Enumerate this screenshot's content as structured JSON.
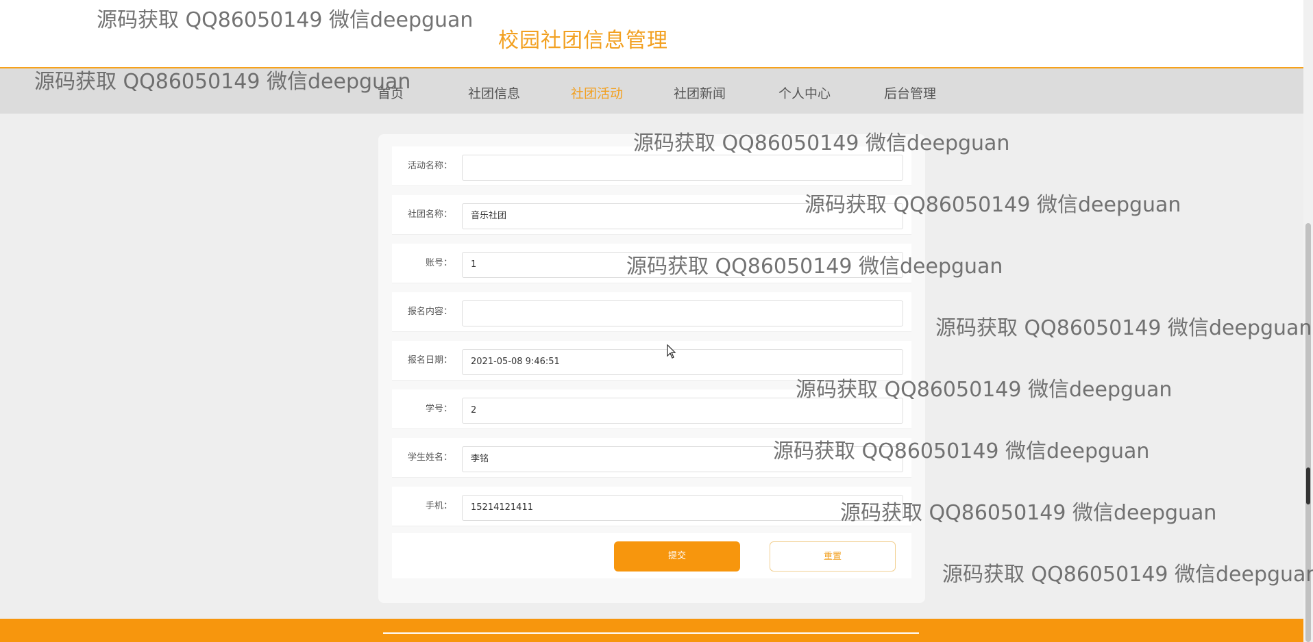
{
  "header": {
    "title": "校园社团信息管理"
  },
  "nav": {
    "items": [
      {
        "label": "首页",
        "active": false
      },
      {
        "label": "社团信息",
        "active": false
      },
      {
        "label": "社团活动",
        "active": true
      },
      {
        "label": "社团新闻",
        "active": false
      },
      {
        "label": "个人中心",
        "active": false
      },
      {
        "label": "后台管理",
        "active": false
      }
    ]
  },
  "form": {
    "fields": [
      {
        "label": "活动名称：",
        "value": ""
      },
      {
        "label": "社团名称：",
        "value": "音乐社团"
      },
      {
        "label": "账号：",
        "value": "1"
      },
      {
        "label": "报名内容：",
        "value": ""
      },
      {
        "label": "报名日期：",
        "value": "2021-05-08 9:46:51"
      },
      {
        "label": "学号：",
        "value": "2"
      },
      {
        "label": "学生姓名：",
        "value": "李铭"
      },
      {
        "label": "手机：",
        "value": "15214121411"
      }
    ],
    "submit_label": "提交",
    "reset_label": "重置"
  },
  "watermark": {
    "text": "源码获取 QQ86050149 微信deepguan"
  },
  "colors": {
    "accent": "#f7960d",
    "nav_bg": "#dcdcdc",
    "page_bg": "#eeeeee"
  },
  "icons": {
    "cursor": "mouse-pointer-icon"
  }
}
